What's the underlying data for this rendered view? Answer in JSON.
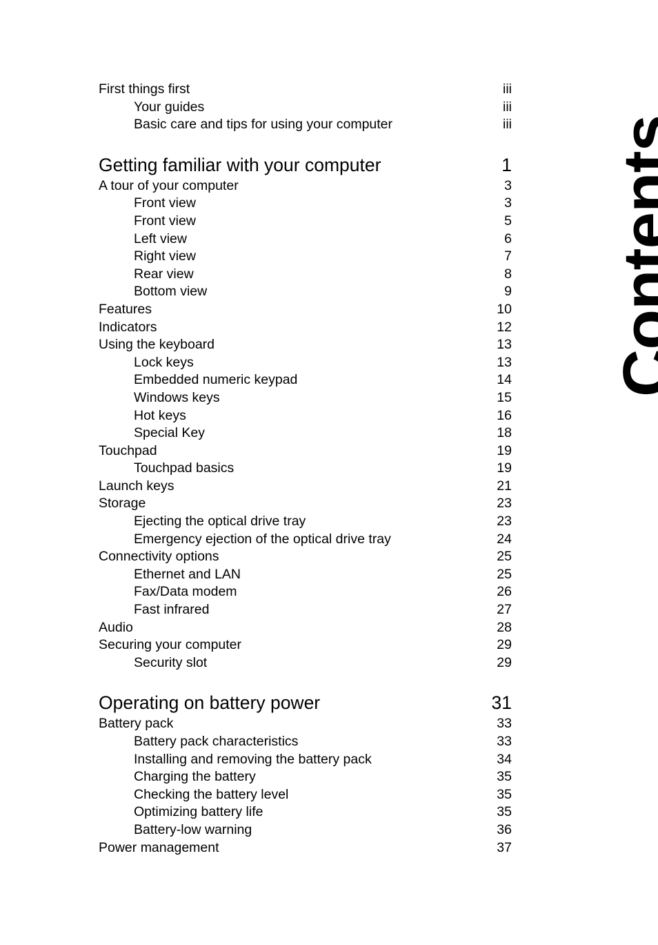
{
  "page": {
    "side_title": "Contents"
  },
  "toc": {
    "entries": [
      {
        "label": "First things first",
        "page": "iii",
        "level": 1,
        "gap_before": false
      },
      {
        "label": "Your guides",
        "page": "iii",
        "level": 2,
        "gap_before": false
      },
      {
        "label": "Basic care and tips for using your computer",
        "page": "iii",
        "level": 2,
        "gap_before": false
      },
      {
        "label": "Getting familiar with your computer",
        "page": "1",
        "level": 0,
        "gap_before": true
      },
      {
        "label": "A tour of your computer",
        "page": "3",
        "level": 1,
        "gap_before": false
      },
      {
        "label": "Front view",
        "page": "3",
        "level": 2,
        "gap_before": false
      },
      {
        "label": "Front view",
        "page": "5",
        "level": 2,
        "gap_before": false
      },
      {
        "label": "Left view",
        "page": "6",
        "level": 2,
        "gap_before": false
      },
      {
        "label": "Right view",
        "page": "7",
        "level": 2,
        "gap_before": false
      },
      {
        "label": "Rear view",
        "page": "8",
        "level": 2,
        "gap_before": false
      },
      {
        "label": "Bottom view",
        "page": "9",
        "level": 2,
        "gap_before": false
      },
      {
        "label": "Features",
        "page": "10",
        "level": 1,
        "gap_before": false
      },
      {
        "label": "Indicators",
        "page": "12",
        "level": 1,
        "gap_before": false
      },
      {
        "label": "Using the keyboard",
        "page": "13",
        "level": 1,
        "gap_before": false
      },
      {
        "label": "Lock keys",
        "page": "13",
        "level": 2,
        "gap_before": false
      },
      {
        "label": "Embedded numeric keypad",
        "page": "14",
        "level": 2,
        "gap_before": false
      },
      {
        "label": "Windows keys",
        "page": "15",
        "level": 2,
        "gap_before": false
      },
      {
        "label": "Hot keys",
        "page": "16",
        "level": 2,
        "gap_before": false
      },
      {
        "label": "Special Key",
        "page": "18",
        "level": 2,
        "gap_before": false
      },
      {
        "label": "Touchpad",
        "page": "19",
        "level": 1,
        "gap_before": false
      },
      {
        "label": "Touchpad basics",
        "page": "19",
        "level": 2,
        "gap_before": false
      },
      {
        "label": "Launch keys",
        "page": "21",
        "level": 1,
        "gap_before": false
      },
      {
        "label": "Storage",
        "page": "23",
        "level": 1,
        "gap_before": false
      },
      {
        "label": "Ejecting the optical drive tray",
        "page": "23",
        "level": 2,
        "gap_before": false
      },
      {
        "label": "Emergency ejection of the optical drive tray",
        "page": "24",
        "level": 2,
        "gap_before": false
      },
      {
        "label": "Connectivity options",
        "page": "25",
        "level": 1,
        "gap_before": false
      },
      {
        "label": "Ethernet and LAN",
        "page": "25",
        "level": 2,
        "gap_before": false
      },
      {
        "label": "Fax/Data modem",
        "page": "26",
        "level": 2,
        "gap_before": false
      },
      {
        "label": "Fast infrared",
        "page": "27",
        "level": 2,
        "gap_before": false
      },
      {
        "label": "Audio",
        "page": "28",
        "level": 1,
        "gap_before": false
      },
      {
        "label": "Securing your computer",
        "page": "29",
        "level": 1,
        "gap_before": false
      },
      {
        "label": "Security slot",
        "page": "29",
        "level": 2,
        "gap_before": false
      },
      {
        "label": "Operating on battery power",
        "page": "31",
        "level": 0,
        "gap_before": true
      },
      {
        "label": "Battery pack",
        "page": "33",
        "level": 1,
        "gap_before": false
      },
      {
        "label": "Battery pack characteristics",
        "page": "33",
        "level": 2,
        "gap_before": false
      },
      {
        "label": "Installing and removing the battery pack",
        "page": "34",
        "level": 2,
        "gap_before": false
      },
      {
        "label": "Charging the battery",
        "page": "35",
        "level": 2,
        "gap_before": false
      },
      {
        "label": "Checking the battery level",
        "page": "35",
        "level": 2,
        "gap_before": false
      },
      {
        "label": "Optimizing battery life",
        "page": "35",
        "level": 2,
        "gap_before": false
      },
      {
        "label": "Battery-low warning",
        "page": "36",
        "level": 2,
        "gap_before": false
      },
      {
        "label": "Power management",
        "page": "37",
        "level": 1,
        "gap_before": false
      }
    ]
  }
}
